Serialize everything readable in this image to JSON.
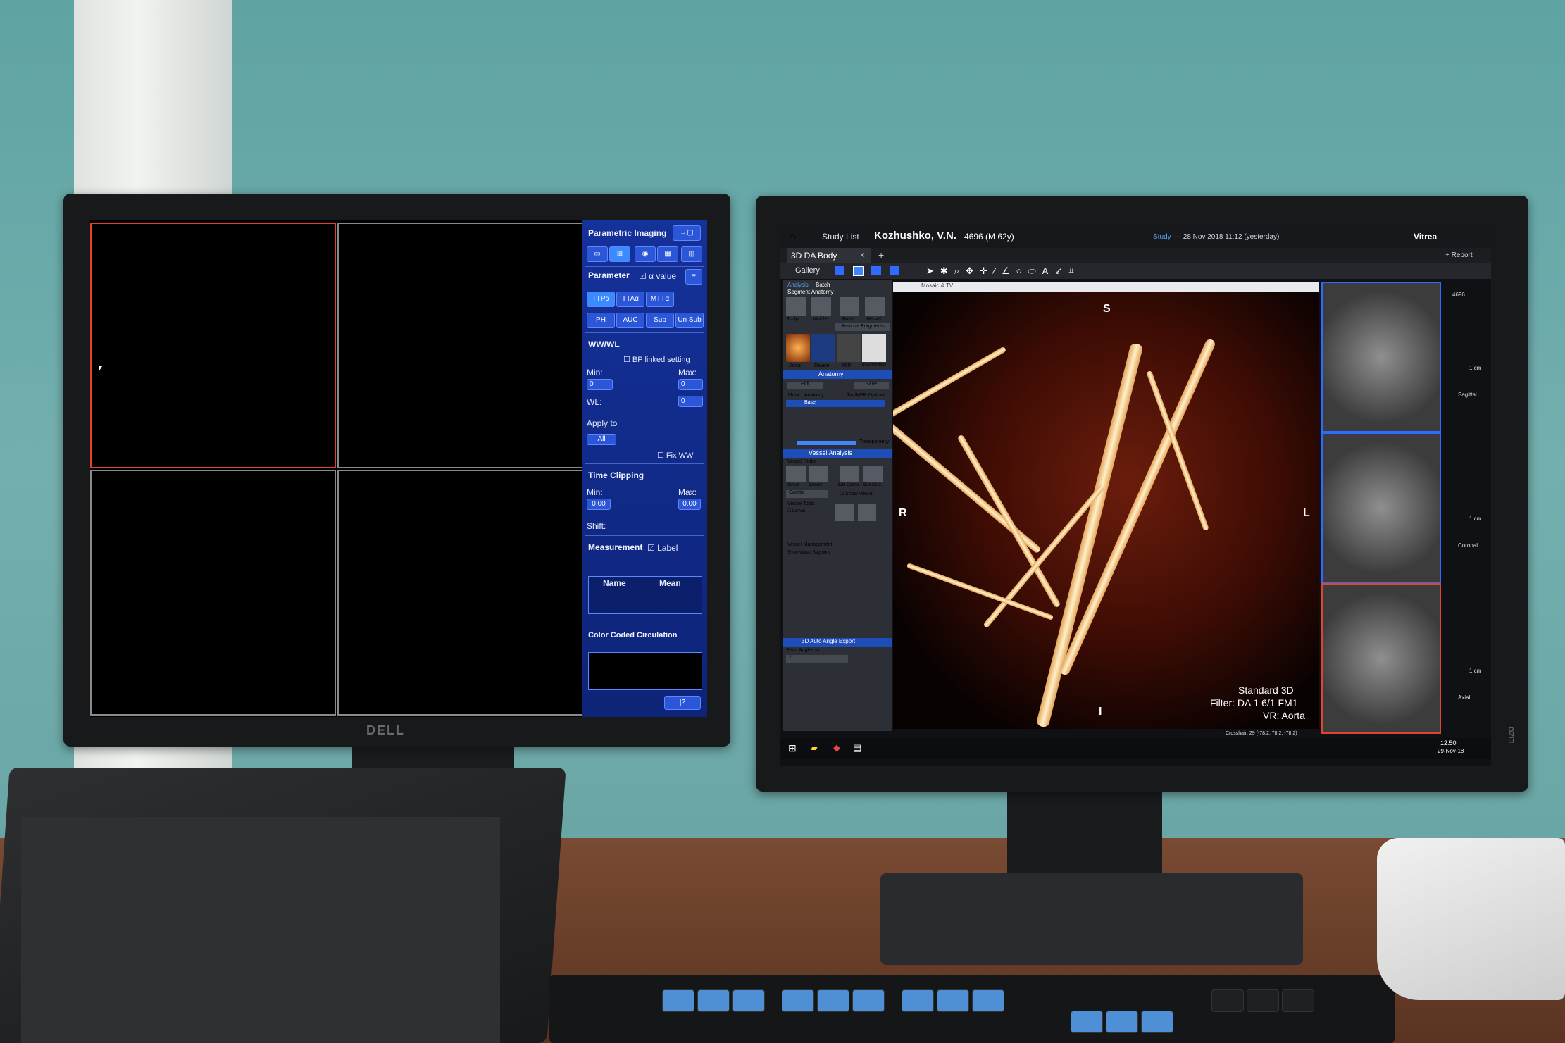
{
  "left_monitor": {
    "brand": "DELL",
    "panel": {
      "parametric_title": "Parametric Imaging",
      "parameter_label": "Parameter",
      "alpha_value_label": "α value",
      "param_buttons": [
        "TTPα",
        "TTAα",
        "MTTα",
        "PH",
        "AUC",
        "Sub",
        "Un Sub"
      ],
      "wwwl_label": "WW/WL",
      "bp_linked": "BP linked setting",
      "min_label": "Min:",
      "max_label": "Max:",
      "min_value": "0",
      "max_value": "0",
      "wl_label": "WL:",
      "wl_value": "0",
      "apply_to": "Apply to",
      "all_label": "All",
      "fix_ww": "Fix WW",
      "time_clipping": "Time Clipping",
      "tc_min": "0.00",
      "tc_max": "0.00",
      "shift_label": "Shift:",
      "measurement": "Measurement",
      "label_check": "Label",
      "col_name": "Name",
      "col_mean": "Mean",
      "color_coded": "Color Coded Circulation"
    }
  },
  "right_monitor": {
    "brand": "EIZO",
    "header": {
      "study_list": "Study List",
      "patient_name": "Kozhushko, V.N.",
      "patient_id": "4696 (M 62y)",
      "study_label": "Study",
      "study_date": "— 28 Nov 2018 11:12 (yesterday)",
      "app": "Vitrea"
    },
    "tab_label": "3D DA Body",
    "gallery": "Gallery",
    "report": "+ Report",
    "sidepanel": {
      "analysis": "Analysis",
      "batch": "Batch",
      "segment_anatomy": "Segment Anatomy",
      "tools": [
        "Sculpt",
        "Visible",
        "Bone",
        "Vessel"
      ],
      "remove_fragments": "Remove Fragments",
      "presets": [
        "Aorta",
        "Device",
        "MIP",
        "Inverted MIP"
      ],
      "anatomy": "Anatomy",
      "edit": "Edit",
      "save": "Save",
      "show": "Show",
      "anatomy_col": "Anatomy",
      "tint_options": "Tint/MPR Options",
      "base": "Base",
      "transparency": "Transparency",
      "vessel_analysis": "Vessel Analysis",
      "vessel_probe": "Vessel Probe",
      "probe_tools": [
        "Select",
        "Extend",
        "Edit Center",
        "Edit Cont."
      ],
      "carotid": "Carotid",
      "show_vessel": "Show Vessel",
      "vessel_tools": "Vessel Tools",
      "lumen": "Lumen",
      "vessel_mgmt": "Vessel Management",
      "show_vessel_segment": "Show  Vessel Segment",
      "auto_angle": "3D Auto Angle Export",
      "send_angles": "Send Angles to:",
      "send_value": "1"
    },
    "vr": {
      "window_title": "Mosaic & TV",
      "orient_s": "S",
      "orient_r": "R",
      "orient_l": "L",
      "orient_i": "I",
      "overlay_1": "Standard 3D",
      "overlay_2": "Filter: DA 1 6/1 FM1",
      "overlay_3": "VR: Aorta"
    },
    "crosshair": "Crosshair: 29 (-78.2, 78.2, -78.2)",
    "thumb_labels": [
      "4696",
      "1 cm",
      "Sagittal",
      "1 cm",
      "Coronal",
      "1 cm",
      "Axial"
    ],
    "taskbar_time": "12:50",
    "taskbar_date": "29-Nov-18"
  }
}
